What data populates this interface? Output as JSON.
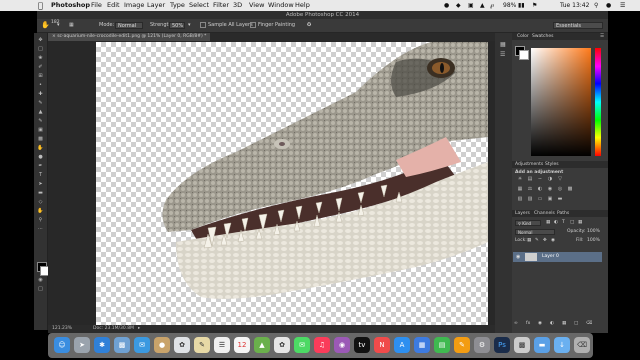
{
  "menubar": {
    "app": "Photoshop",
    "items": [
      "File",
      "Edit",
      "Image",
      "Layer",
      "Type",
      "Select",
      "Filter",
      "3D",
      "View",
      "Window",
      "Help"
    ],
    "battery": "98%",
    "time": "Tue 13:42"
  },
  "window": {
    "title": "Adobe Photoshop CC 2014"
  },
  "options": {
    "brush_size": "182",
    "mode_label": "Mode:",
    "mode_value": "Normal",
    "strength_label": "Strength:",
    "strength_value": "50%",
    "sample_all_layers": "Sample All Layers",
    "finger_painting": "Finger Painting",
    "workspace": "Essentials"
  },
  "document": {
    "tab_label": "sc-aquarium-nile-crocodile-edit1.png @ 121% (Layer 0, RGB/8#) *",
    "zoom": "121.23%",
    "doc_size": "Doc: 23.1M/30.8M"
  },
  "panels": {
    "color_tabs": [
      "Color",
      "Swatches"
    ],
    "adjust_tabs": [
      "Adjustments",
      "Styles"
    ],
    "adjust_heading": "Add an adjustment",
    "layers_tabs": [
      "Layers",
      "Channels",
      "Paths"
    ],
    "kind_label": "Kind",
    "blend_mode": "Normal",
    "opacity_label": "Opacity:",
    "opacity_value": "100%",
    "lock_label": "Lock:",
    "fill_label": "Fill:",
    "fill_value": "100%",
    "layer_name": "Layer 0"
  },
  "colors": {
    "accent": "#5b6f88",
    "foreground": "#000000",
    "background": "#ffffff"
  },
  "dock": {
    "icons": [
      "finder-icon",
      "launchpad-icon",
      "safari-icon",
      "preview-icon",
      "photos-icon",
      "mail-icon",
      "contacts-icon",
      "calendar-icon",
      "notes-icon",
      "reminders-icon",
      "maps-icon",
      "photos-app-icon",
      "messages-icon",
      "facetime-icon",
      "music-icon",
      "podcasts-icon",
      "tv-icon",
      "news-icon",
      "app-store-icon",
      "keynote-icon",
      "numbers-icon",
      "pages-icon",
      "system-preferences-icon",
      "photoshop-icon",
      "preview2-icon",
      "folder-icon",
      "trash-icon"
    ],
    "calendar_day": "12",
    "tv_label": "tv"
  }
}
